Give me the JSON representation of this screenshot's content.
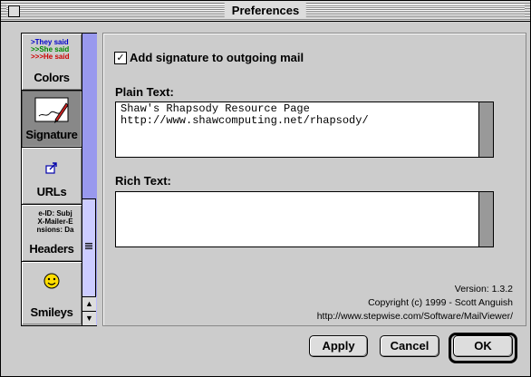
{
  "window": {
    "title": "Preferences"
  },
  "sidebar": {
    "items": [
      {
        "label": "Colors",
        "glyph_lines": [
          ">They said",
          ">>She said",
          ">>>He said"
        ],
        "glyph_colors": [
          "#0000cc",
          "#008800",
          "#cc0000"
        ]
      },
      {
        "label": "Signature",
        "icon": "signature-pen-icon",
        "selected": true
      },
      {
        "label": "URLs",
        "icon": "url-arrow-icon"
      },
      {
        "label": "Headers",
        "glyph_lines": [
          "e-ID: Subj",
          "X-Mailer-E",
          "nsions: Da"
        ]
      },
      {
        "label": "Smileys",
        "icon": "smiley-icon",
        "glyph": "☺"
      }
    ],
    "scroll_up": "▲",
    "scroll_down": "▼"
  },
  "signature": {
    "checkbox_label": "Add signature to outgoing mail",
    "checkbox_mark": "✓",
    "checked": true,
    "plain_label": "Plain Text:",
    "plain_value": "Shaw's Rhapsody Resource Page\nhttp://www.shawcomputing.net/rhapsody/",
    "rich_label": "Rich Text:",
    "rich_value": ""
  },
  "about": {
    "version": "Version: 1.3.2",
    "copyright": "Copyright (c) 1999 - Scott Anguish",
    "url": "http://www.stepwise.com/Software/MailViewer/"
  },
  "buttons": {
    "apply": "Apply",
    "cancel": "Cancel",
    "ok": "OK"
  }
}
